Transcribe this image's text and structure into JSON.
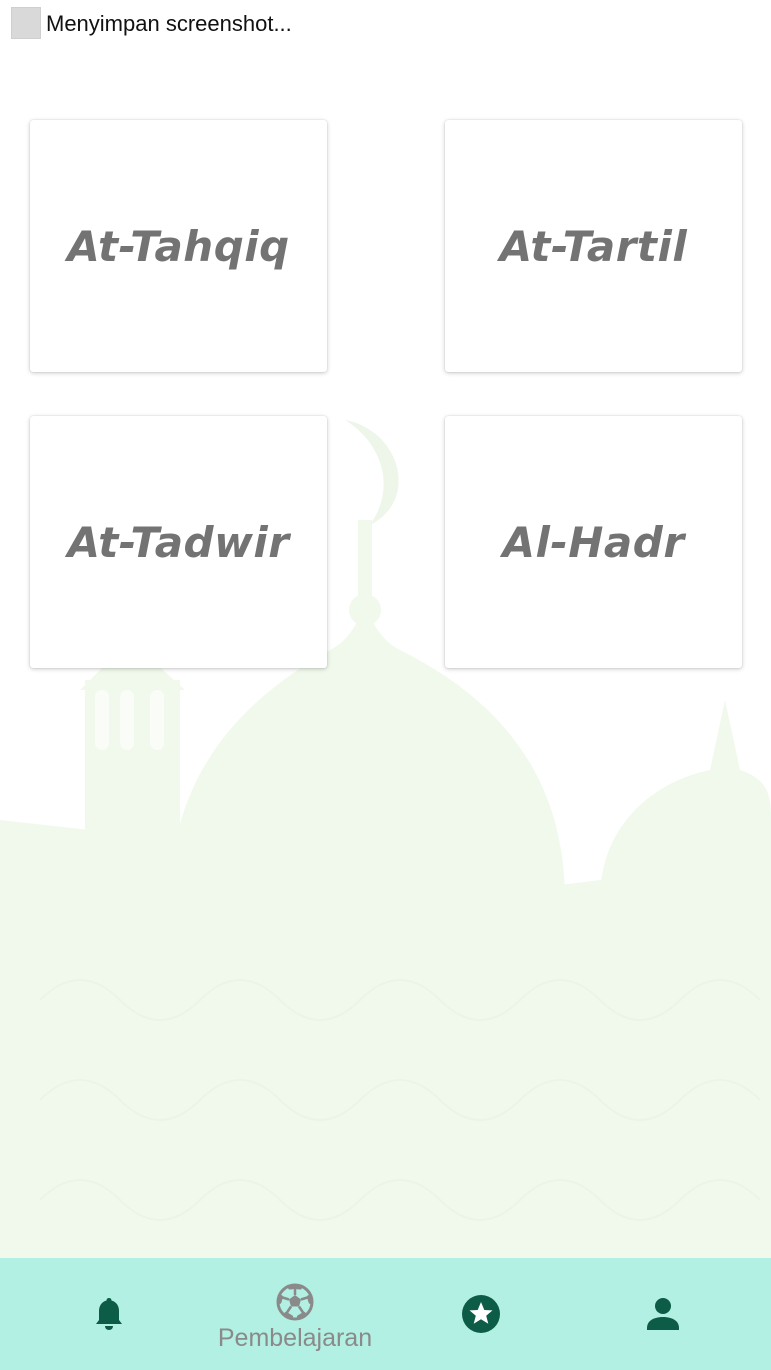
{
  "status": {
    "text": "Menyimpan screenshot..."
  },
  "cards": [
    {
      "label": "At-Tahqiq"
    },
    {
      "label": "At-Tartil"
    },
    {
      "label": "At-Tadwir"
    },
    {
      "label": "Al-Hadr"
    }
  ],
  "bottom_nav": {
    "items": [
      {
        "icon": "bell-icon",
        "label": ""
      },
      {
        "icon": "soccer-ball-icon",
        "label": "Pembelajaran"
      },
      {
        "icon": "star-circle-icon",
        "label": ""
      },
      {
        "icon": "person-icon",
        "label": ""
      }
    ],
    "active_index": 1
  },
  "colors": {
    "nav_background": "#b1f0e3",
    "icon_dark_green": "#0d5c48",
    "card_text": "#737373",
    "background_art": "#eef8ea"
  }
}
